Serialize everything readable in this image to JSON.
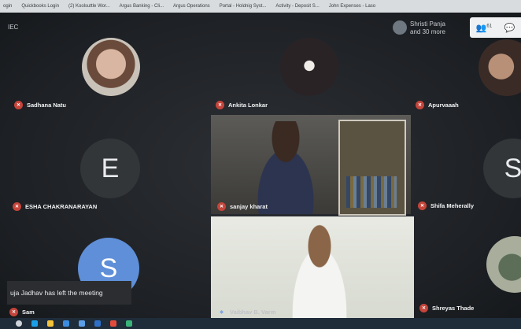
{
  "browser": {
    "bookmarks": [
      "ogin",
      "Quickbooks Login",
      "(2) Koolsuttle Wor...",
      "Argus Banking - Cli...",
      "Argus Operations",
      "Portal - Holdnig Syst...",
      "Activity - Deposit S...",
      "John Expenses - Laso"
    ]
  },
  "meeting": {
    "code": "IEC",
    "people_count_line1": "Shristi Panja",
    "people_count_line2": "and 30 more",
    "participants_badge": "61",
    "toast": "uja Jadhav has left the meeting"
  },
  "participants": {
    "sadhana": "Sadhana Natu",
    "ankita": "Ankita Lonkar",
    "apurvaah": "Apurvaaah",
    "esha": "ESHA CHAKRANARAYAN",
    "esha_initial": "E",
    "sanjay": "sanjay kharat",
    "shifa": "Shifa Meherally",
    "shifa_initial": "S",
    "sam": "Sam",
    "sam_initial": "S",
    "vaibhav": "Vaibhav B. Varm",
    "shreyas": "Shreyas Thade"
  },
  "colors": {
    "mic_off": "#c5453b",
    "tile_bg": "#1f2226",
    "sam_avatar": "#5f8fd8"
  }
}
